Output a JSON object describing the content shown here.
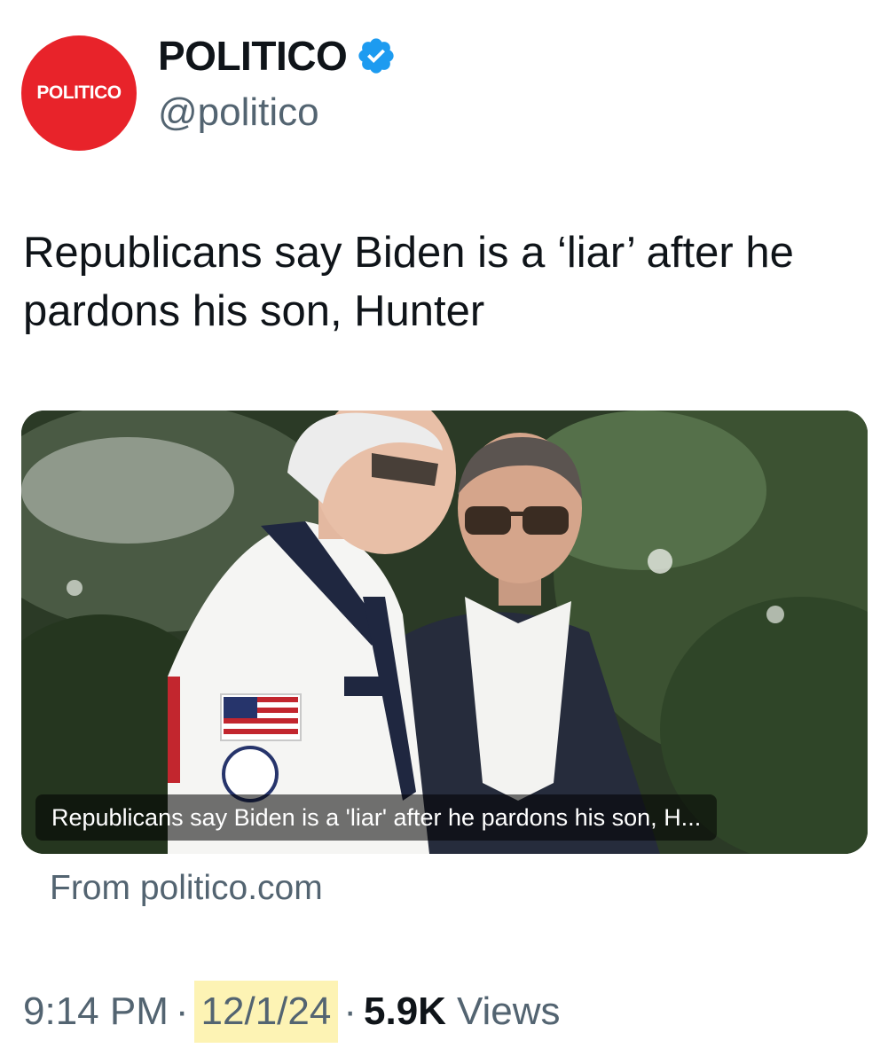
{
  "tweet": {
    "author": {
      "avatar_text": "POLITICO",
      "display_name": "POLITICO",
      "handle": "@politico",
      "verified_icon": "verified-badge-icon",
      "brand_color": "#e8232a"
    },
    "text": "Republicans say Biden is a ‘liar’ after he pardons his son, Hunter",
    "card": {
      "caption": "Republicans say Biden is a 'liar' after he pardons his son, H...",
      "source": "From politico.com"
    },
    "meta": {
      "time": "9:14 PM",
      "separator": "·",
      "date": "12/1/24",
      "views_count": "5.9K",
      "views_label": "Views"
    }
  },
  "colors": {
    "text_primary": "#0f1419",
    "text_secondary": "#536471",
    "verified_blue": "#1d9bf0",
    "date_highlight": "#fdf3b4"
  }
}
